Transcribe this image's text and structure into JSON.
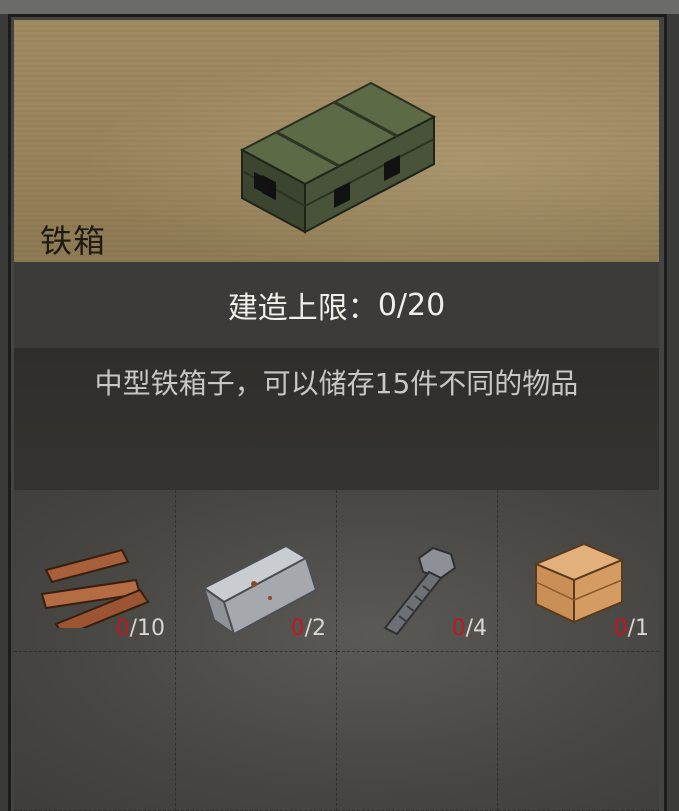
{
  "item": {
    "name": "铁箱",
    "build_limit_label": "建造上限：",
    "build_limit_value": "0/20",
    "description": "中型铁箱子，可以储存15件不同的物品"
  },
  "materials": [
    {
      "name": "wood-plank-icon",
      "have": "0",
      "need": "/10"
    },
    {
      "name": "iron-ingot-icon",
      "have": "0",
      "need": "/2"
    },
    {
      "name": "bolt-icon",
      "have": "0",
      "need": "/4"
    },
    {
      "name": "wooden-crate-icon",
      "have": "0",
      "need": "/1"
    }
  ],
  "colors": {
    "banner": "#9a845b",
    "have_count": "#c4161c",
    "text_light": "#f1efe9"
  }
}
